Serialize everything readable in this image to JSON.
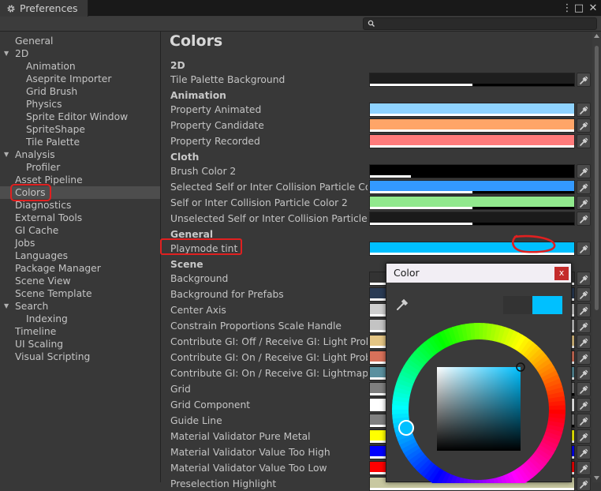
{
  "window": {
    "title": "Preferences",
    "menu_icon": "⋮",
    "maximize_icon": "□",
    "close_icon": "✕"
  },
  "search": {
    "placeholder": "",
    "value": ""
  },
  "sidebar": {
    "items": [
      {
        "label": "General",
        "indent": 0,
        "arrow": ""
      },
      {
        "label": "2D",
        "indent": 0,
        "arrow": "▼"
      },
      {
        "label": "Animation",
        "indent": 2,
        "arrow": ""
      },
      {
        "label": "Aseprite Importer",
        "indent": 2,
        "arrow": ""
      },
      {
        "label": "Grid Brush",
        "indent": 2,
        "arrow": ""
      },
      {
        "label": "Physics",
        "indent": 2,
        "arrow": ""
      },
      {
        "label": "Sprite Editor Window",
        "indent": 2,
        "arrow": ""
      },
      {
        "label": "SpriteShape",
        "indent": 2,
        "arrow": ""
      },
      {
        "label": "Tile Palette",
        "indent": 2,
        "arrow": ""
      },
      {
        "label": "Analysis",
        "indent": 0,
        "arrow": "▼"
      },
      {
        "label": "Profiler",
        "indent": 2,
        "arrow": ""
      },
      {
        "label": "Asset Pipeline",
        "indent": 0,
        "arrow": ""
      },
      {
        "label": "Colors",
        "indent": 0,
        "arrow": "",
        "selected": true
      },
      {
        "label": "Diagnostics",
        "indent": 0,
        "arrow": ""
      },
      {
        "label": "External Tools",
        "indent": 0,
        "arrow": ""
      },
      {
        "label": "GI Cache",
        "indent": 0,
        "arrow": ""
      },
      {
        "label": "Jobs",
        "indent": 0,
        "arrow": ""
      },
      {
        "label": "Languages",
        "indent": 0,
        "arrow": ""
      },
      {
        "label": "Package Manager",
        "indent": 0,
        "arrow": ""
      },
      {
        "label": "Scene View",
        "indent": 0,
        "arrow": ""
      },
      {
        "label": "Scene Template",
        "indent": 0,
        "arrow": ""
      },
      {
        "label": "Search",
        "indent": 0,
        "arrow": "▼"
      },
      {
        "label": "Indexing",
        "indent": 2,
        "arrow": ""
      },
      {
        "label": "Timeline",
        "indent": 0,
        "arrow": ""
      },
      {
        "label": "UI Scaling",
        "indent": 0,
        "arrow": ""
      },
      {
        "label": "Visual Scripting",
        "indent": 0,
        "arrow": ""
      }
    ]
  },
  "main": {
    "title": "Colors",
    "rows": [
      {
        "type": "header",
        "label": "2D"
      },
      {
        "type": "color",
        "label": "Tile Palette Background",
        "color": "#1e1e1e",
        "alpha": 0.5
      },
      {
        "type": "header",
        "label": "Animation"
      },
      {
        "type": "color",
        "label": "Property Animated",
        "color": "#8fd3ff",
        "alpha": 1.0
      },
      {
        "type": "color",
        "label": "Property Candidate",
        "color": "#ffa568",
        "alpha": 1.0
      },
      {
        "type": "color",
        "label": "Property Recorded",
        "color": "#ff7b7b",
        "alpha": 1.0
      },
      {
        "type": "header",
        "label": "Cloth"
      },
      {
        "type": "color",
        "label": "Brush Color 2",
        "color": "#000000",
        "alpha": 0.2
      },
      {
        "type": "color",
        "label": "Selected Self or Inter Collision Particle Color",
        "color": "#3399ff",
        "alpha": 0.5
      },
      {
        "type": "color",
        "label": "Self or Inter Collision Particle Color 2",
        "color": "#91e98d",
        "alpha": 0.5
      },
      {
        "type": "color",
        "label": "Unselected Self or Inter Collision Particle Color",
        "color": "#1a1a1a",
        "alpha": 0.5
      },
      {
        "type": "header",
        "label": "General"
      },
      {
        "type": "color",
        "label": "Playmode tint",
        "color": "#00c0ff",
        "alpha": 1.0
      },
      {
        "type": "header",
        "label": "Scene"
      },
      {
        "type": "color",
        "label": "Background",
        "color": "#333333",
        "alpha": 1.0
      },
      {
        "type": "color",
        "label": "Background for Prefabs",
        "color": "#2a3b55",
        "alpha": 1.0
      },
      {
        "type": "color",
        "label": "Center Axis",
        "color": "#cfcfcf",
        "alpha": 1.0
      },
      {
        "type": "color",
        "label": "Constrain Proportions Scale Handle",
        "color": "#c3c3c3",
        "alpha": 1.0
      },
      {
        "type": "color",
        "label": "Contribute GI: Off / Receive GI: Light Probes",
        "color": "#e4c584",
        "alpha": 1.0
      },
      {
        "type": "color",
        "label": "Contribute GI: On / Receive GI: Light Probes",
        "color": "#d8715a",
        "alpha": 1.0
      },
      {
        "type": "color",
        "label": "Contribute GI: On / Receive GI: Lightmaps",
        "color": "#5a909f",
        "alpha": 1.0
      },
      {
        "type": "color",
        "label": "Grid",
        "color": "#7f7f7f",
        "alpha": 0.5
      },
      {
        "type": "color",
        "label": "Grid Component",
        "color": "#ffffff",
        "alpha": 1.0
      },
      {
        "type": "color",
        "label": "Guide Line",
        "color": "#808080",
        "alpha": 0.5
      },
      {
        "type": "color",
        "label": "Material Validator Pure Metal",
        "color": "#ffff00",
        "alpha": 1.0
      },
      {
        "type": "color",
        "label": "Material Validator Value Too High",
        "color": "#0000ff",
        "alpha": 1.0
      },
      {
        "type": "color",
        "label": "Material Validator Value Too Low",
        "color": "#ff0000",
        "alpha": 1.0
      },
      {
        "type": "color",
        "label": "Preselection Highlight",
        "color": "#c8c8a0",
        "alpha": 1.0
      }
    ]
  },
  "color_popup": {
    "title": "Color",
    "close_label": "x",
    "previous_color": "#333333",
    "current_color": "#00c0ff",
    "eyedropper_icon": "eyedropper-icon"
  },
  "annotation_color": "#e02020"
}
